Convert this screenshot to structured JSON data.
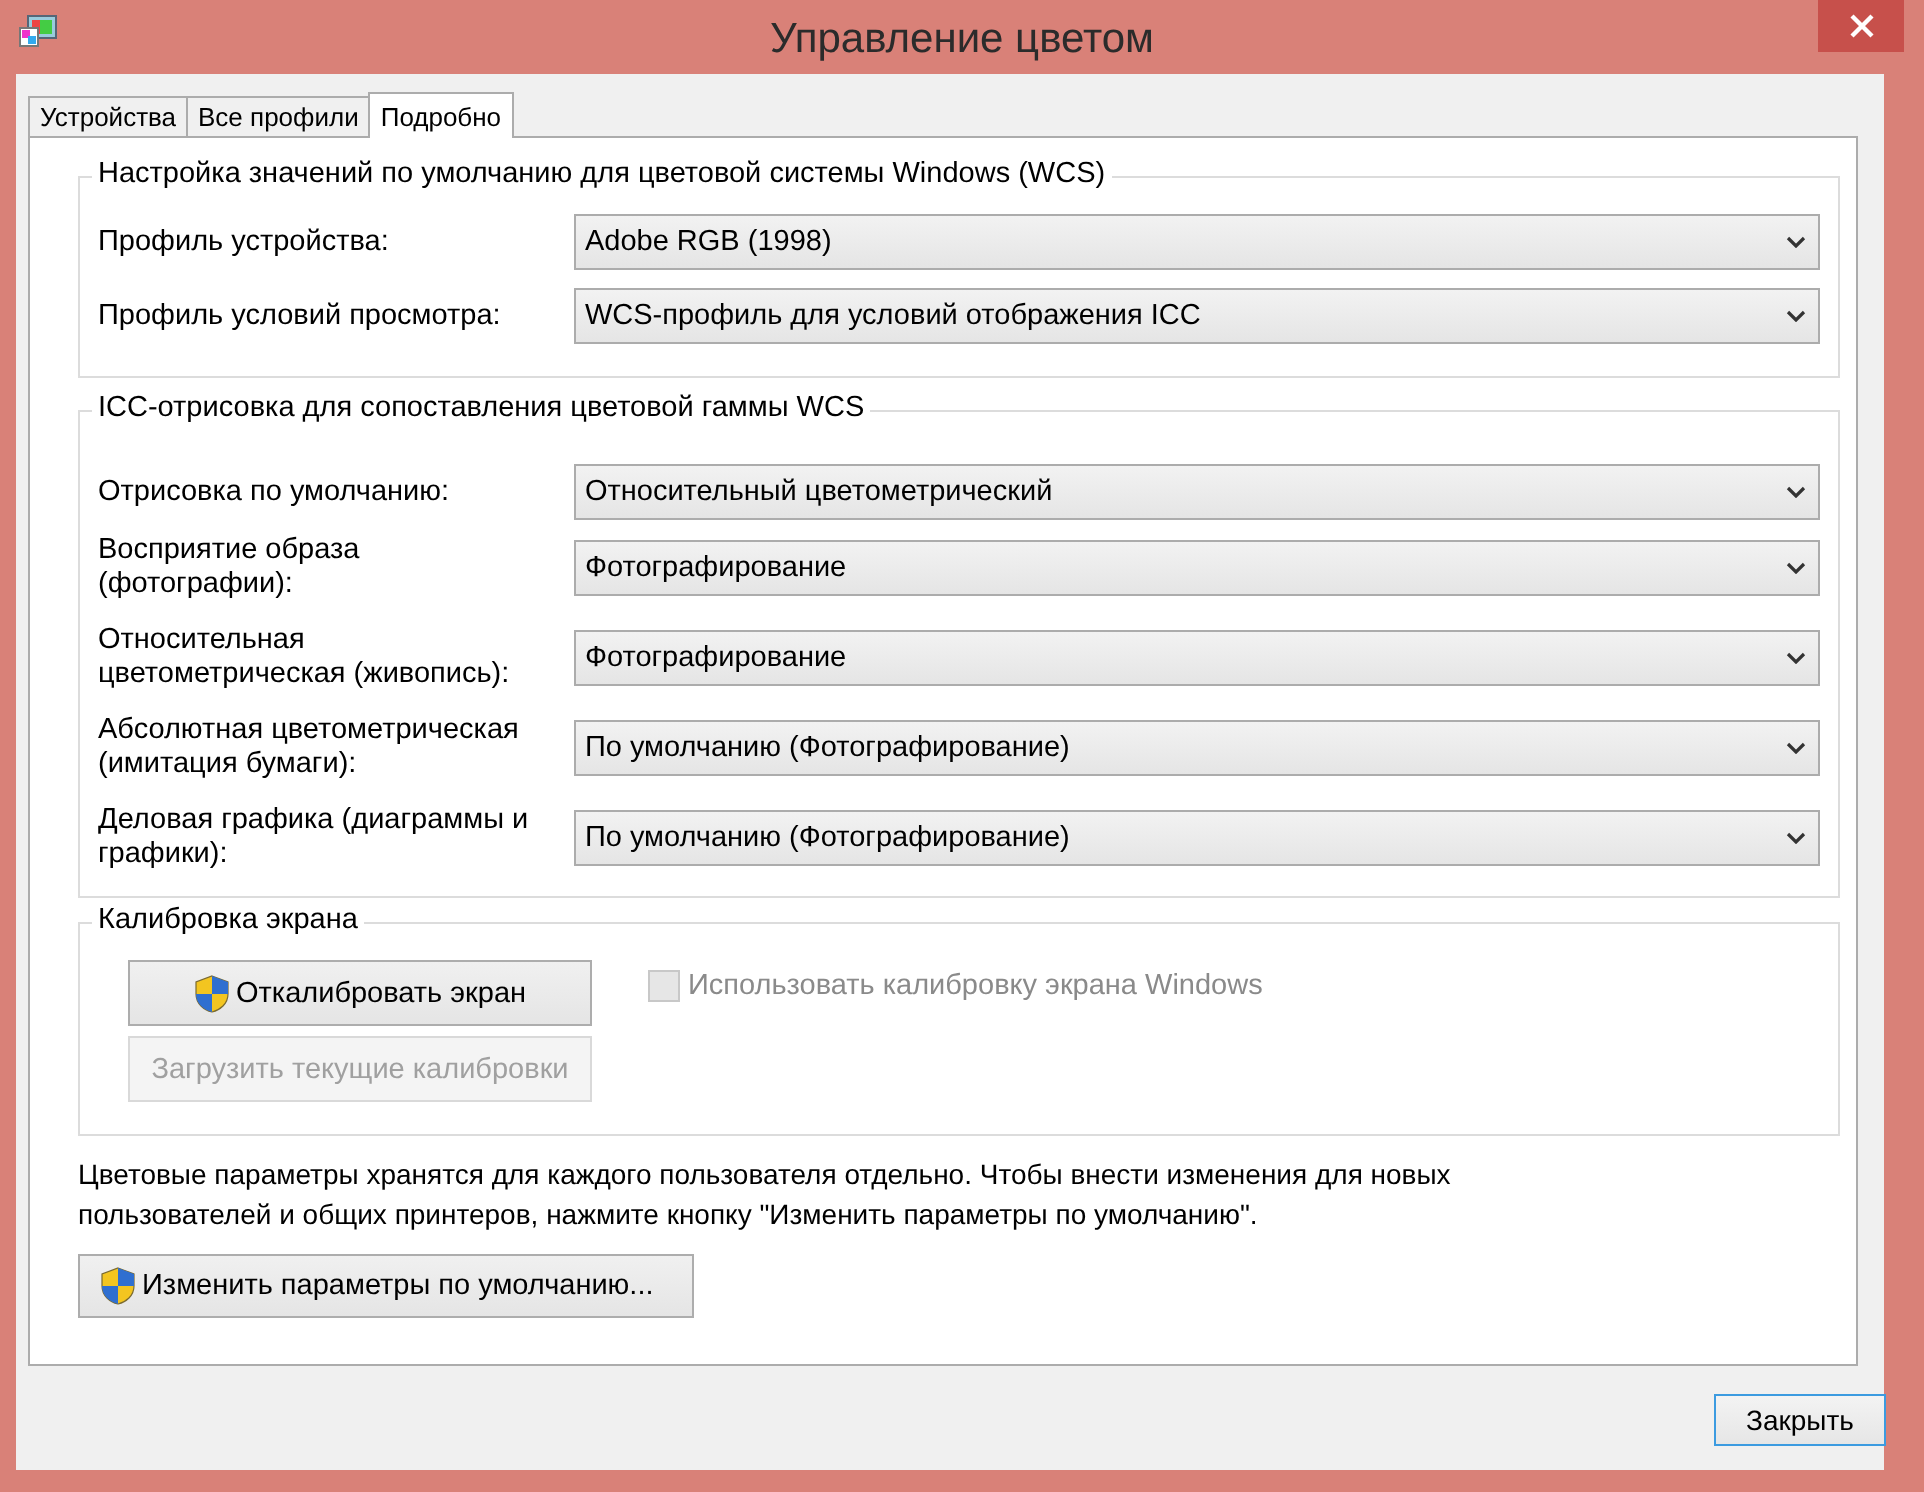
{
  "window": {
    "title": "Управление цветом"
  },
  "tabs": [
    {
      "label": "Устройства",
      "selected": false
    },
    {
      "label": "Все профили",
      "selected": false
    },
    {
      "label": "Подробно",
      "selected": true
    }
  ],
  "groups": [
    {
      "title": "Настройка значений по умолчанию для цветовой системы Windows (WCS)",
      "rows": [
        {
          "label": "Профиль устройства:",
          "value": "Adobe RGB (1998)"
        },
        {
          "label": "Профиль условий просмотра:",
          "value": "WCS-профиль для условий отображения ICC"
        }
      ]
    },
    {
      "title": "ICC-отрисовка для сопоставления цветовой гаммы WCS",
      "rows": [
        {
          "label": "Отрисовка по умолчанию:",
          "value": "Относительный цветометрический"
        },
        {
          "label": "Восприятие образа (фотографии):",
          "value": "Фотографирование"
        },
        {
          "label": "Относительная цветометрическая (живопись):",
          "value": "Фотографирование"
        },
        {
          "label": "Абсолютная цветометрическая (имитация бумаги):",
          "value": "По умолчанию (Фотографирование)"
        },
        {
          "label": "Деловая графика (диаграммы и графики):",
          "value": "По умолчанию (Фотографирование)"
        }
      ]
    }
  ],
  "calibration": {
    "title": "Калибровка экрана",
    "buttons": [
      {
        "label": "Откалибровать экран",
        "shield": true,
        "disabled": false
      },
      {
        "label": "Загрузить текущие калибровки",
        "shield": false,
        "disabled": true
      }
    ],
    "checkbox": {
      "label": "Использовать калибровку экрана Windows",
      "checked": false,
      "disabled": true
    }
  },
  "note": "Цветовые параметры хранятся для каждого пользователя отдельно. Чтобы внести изменения для новых пользователей и общих принтеров, нажмите кнопку \"Изменить параметры по умолчанию\".",
  "change_button": {
    "label": "Изменить параметры по умолчанию...",
    "shield": true
  },
  "close_button": {
    "label": "Закрыть"
  }
}
